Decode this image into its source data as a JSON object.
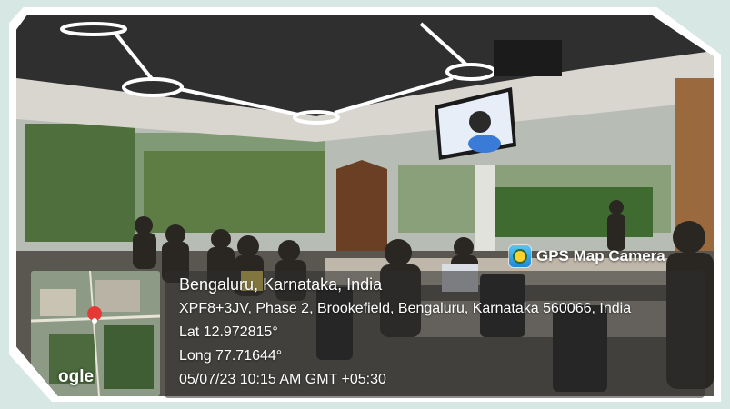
{
  "gps_overlay": {
    "brand": "GPS Map Camera",
    "city": "Bengaluru, Karnataka, India",
    "address": "XPF8+3JV, Phase 2, Brookefield, Bengaluru, Karnataka 560066, India",
    "latitude": "Lat 12.972815°",
    "longitude": "Long 77.71644°",
    "datetime": "05/07/23 10:15 AM GMT +05:30",
    "map_watermark": "ogle",
    "map_pin_color": "#e53935"
  },
  "colors": {
    "border": "#ffffff",
    "background": "#d7e8e4",
    "ceiling": "#2f2f2f",
    "ceiling_light": "#ffffff"
  }
}
